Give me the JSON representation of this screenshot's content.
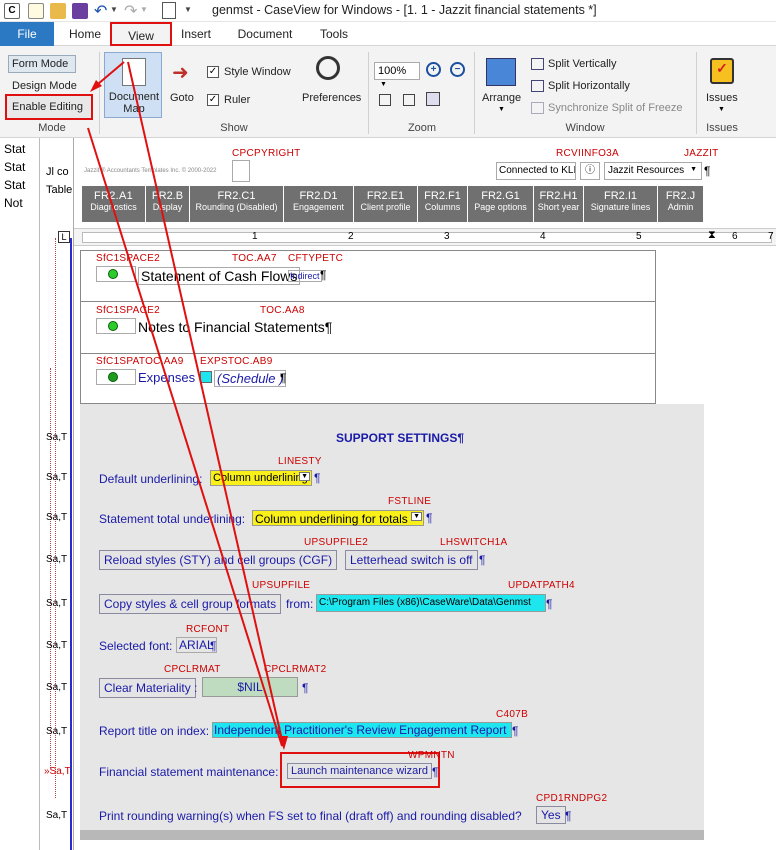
{
  "window": {
    "title": "genmst - CaseView for Windows - [1. 1 - Jazzit financial statements *]"
  },
  "ribbon_tabs": {
    "file": "File",
    "home": "Home",
    "view": "View",
    "insert": "Insert",
    "document": "Document",
    "tools": "Tools"
  },
  "ribbon": {
    "mode": {
      "form_mode": "Form Mode",
      "design_mode": "Design Mode",
      "enable_editing": "Enable Editing",
      "group": "Mode"
    },
    "show": {
      "document_map": "Document Map",
      "goto": "Goto",
      "style_window": "Style Window",
      "ruler": "Ruler",
      "preferences": "Preferences",
      "group": "Show"
    },
    "zoom": {
      "value": "100%",
      "group": "Zoom"
    },
    "window": {
      "arrange": "Arrange",
      "split_vertically": "Split Vertically",
      "split_horizontally": "Split Horizontally",
      "sync_split": "Synchronize Split of Freeze",
      "group": "Window"
    },
    "issues": {
      "label": "Issues",
      "group": "Issues"
    }
  },
  "sidebar": {
    "items": [
      "Stat",
      "Stat",
      "Stat",
      "Not"
    ]
  },
  "left_partial": {
    "jl": "Jl co",
    "table": "Table",
    "row_label": "Sa,T",
    "row_label_alt": "»Sa,T"
  },
  "header_area": {
    "cpcpyright": "CPCPYRIGHT",
    "rcvinfo": "RCVIINFO3A",
    "jazzit": "JAZZIT",
    "connected": "Connected to KLIE",
    "jazzit_resources": "Jazzit Resources",
    "copyright_text": "Jazzit ® Accountants Templates Inc. © 2000-2022"
  },
  "sections": [
    {
      "code": "FR2.A1",
      "name": "Diagnostics"
    },
    {
      "code": "FR2.B",
      "name": "Display"
    },
    {
      "code": "FR2.C1",
      "name": "Rounding (Disabled)"
    },
    {
      "code": "FR2.D1",
      "name": "Engagement"
    },
    {
      "code": "FR2.E1",
      "name": "Client profile"
    },
    {
      "code": "FR2.F1",
      "name": "Columns"
    },
    {
      "code": "FR2.G1",
      "name": "Page options"
    },
    {
      "code": "FR2.H1",
      "name": "Short year"
    },
    {
      "code": "FR2.I1",
      "name": "Signature lines"
    },
    {
      "code": "FR2.J",
      "name": "Admin"
    }
  ],
  "ruler": {
    "marks": [
      "1",
      "2",
      "3",
      "4",
      "5",
      "6",
      "7"
    ]
  },
  "toc_rows": [
    {
      "tag1": "SfC1SPACE2",
      "tag2": "TOC.AA7",
      "tag3": "CFTYPETC",
      "label": "Statement of Cash Flows",
      "badge": "Indirect",
      "pil": "¶"
    },
    {
      "tag1": "SfC1SPACE2",
      "tag2": "TOC.AA8",
      "label": "Notes to Financial Statements¶"
    },
    {
      "tag1": "SfC1SPATOC.AA9",
      "tag2": "EXPSTOC.AB9",
      "label": "Expenses",
      "badge": "(Schedule )",
      "pil": "¶"
    }
  ],
  "support": {
    "heading": "SUPPORT SETTINGS¶",
    "linesty": "LINESTY",
    "default_underlining": "Default underlining:",
    "column_underlining": "Column underlining",
    "fstline": "FSTLINE",
    "statement_total": "Statement total underlining:",
    "column_underlining_totals": "Column underlining for totals",
    "upsupfile2": "UPSUPFILE2",
    "lhswitch": "LHSWITCH1A",
    "reload_styles": "Reload styles (STY) and cell groups (CGF)",
    "letterhead": "Letterhead switch is off",
    "upsupfile": "UPSUPFILE",
    "updatpath": "UPDATPATH4",
    "copy_styles": "Copy styles & cell group formats",
    "from": "from:",
    "path": "C:\\Program Files (x86)\\CaseWare\\Data\\Genmst",
    "rcfont": "RCFONT",
    "selected_font": "Selected font:",
    "font_value": "ARIAL",
    "cpclrmat": "CPCLRMAT",
    "cpclrmat2": "CPCLRMAT2",
    "clear_materiality": "Clear Materiality",
    "materiality_value": "$NIL",
    "c407b": "C407B",
    "report_title": "Report title on index:",
    "report_title_value": "Independent Practitioner's Review Engagement Report",
    "wpmntn": "WPMNTN",
    "fs_maintenance": "Financial statement maintenance:",
    "launch_wizard": "Launch maintenance wizard",
    "cpd1rndpg2": "CPD1RNDPG2",
    "rounding_warning": "Print rounding warning(s) when FS set to final (draft off) and rounding disabled?",
    "yes": "Yes"
  },
  "colors": {
    "file_tab": "#2b79c2",
    "highlight": "#e01010",
    "section_bar": "#707070",
    "link_blue": "#1a1aa8",
    "yellow_field": "#f8f018",
    "cyan_field": "#1ee6ee"
  }
}
